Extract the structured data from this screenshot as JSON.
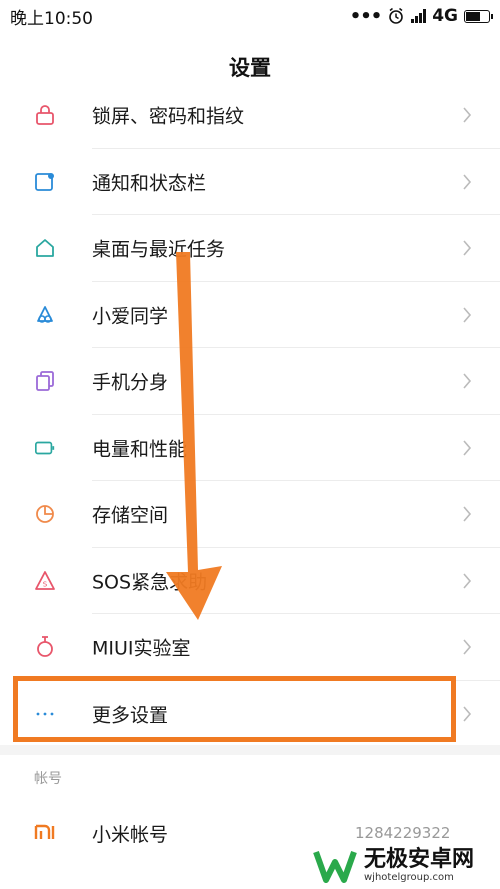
{
  "status_bar": {
    "time": "晚上10:50",
    "dots": "•••",
    "network": "4G",
    "battery_level": 0.7
  },
  "header": {
    "title": "设置"
  },
  "items": [
    {
      "label": "锁屏、密码和指纹",
      "icon": "lock-icon"
    },
    {
      "label": "通知和状态栏",
      "icon": "notification-icon"
    },
    {
      "label": "桌面与最近任务",
      "icon": "home-icon"
    },
    {
      "label": "小爱同学",
      "icon": "xiaoai-icon"
    },
    {
      "label": "手机分身",
      "icon": "second-space-icon"
    },
    {
      "label": "电量和性能",
      "icon": "battery-icon"
    },
    {
      "label": "存储空间",
      "icon": "storage-icon"
    },
    {
      "label": "SOS紧急求助",
      "icon": "sos-icon"
    },
    {
      "label": "MIUI实验室",
      "icon": "lab-flask-icon"
    },
    {
      "label": "更多设置",
      "icon": "more-dots-icon"
    }
  ],
  "section": {
    "account_title": "帐号"
  },
  "account": {
    "label": "小米帐号",
    "value": "1284229322",
    "icon": "mi-logo-icon"
  },
  "watermark": {
    "main": "无极安卓网",
    "url": "wjhotelgroup.com"
  },
  "colors": {
    "highlight": "#f07a22",
    "arrow": "#f07a22"
  }
}
